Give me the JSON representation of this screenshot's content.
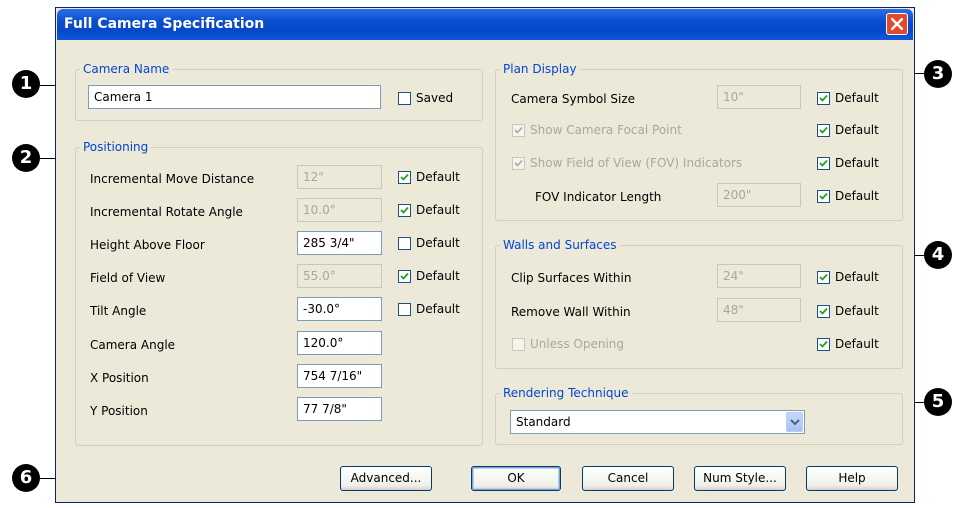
{
  "window": {
    "title": "Full Camera Specification"
  },
  "camera_name": {
    "legend": "Camera Name",
    "value": "Camera 1",
    "saved_label": "Saved",
    "saved_checked": false
  },
  "positioning": {
    "legend": "Positioning",
    "rows": [
      {
        "label": "Incremental Move Distance",
        "value": "12\"",
        "enabled": false,
        "default_label": "Default",
        "default_checked": true
      },
      {
        "label": "Incremental Rotate Angle",
        "value": "10.0°",
        "enabled": false,
        "default_label": "Default",
        "default_checked": true
      },
      {
        "label": "Height Above Floor",
        "value": "285 3/4\"",
        "enabled": true,
        "default_label": "Default",
        "default_checked": false
      },
      {
        "label": "Field of View",
        "value": "55.0°",
        "enabled": false,
        "default_label": "Default",
        "default_checked": true
      },
      {
        "label": "Tilt Angle",
        "value": "-30.0°",
        "enabled": true,
        "default_label": "Default",
        "default_checked": false
      },
      {
        "label": "Camera Angle",
        "value": "120.0°",
        "enabled": true
      },
      {
        "label": "X Position",
        "value": "754 7/16\"",
        "enabled": true
      },
      {
        "label": "Y Position",
        "value": "77 7/8\"",
        "enabled": true
      }
    ]
  },
  "plan_display": {
    "legend": "Plan Display",
    "symbol_size_label": "Camera Symbol Size",
    "symbol_size_value": "10\"",
    "show_focal_label": "Show Camera Focal Point",
    "show_fov_label": "Show Field of View (FOV) Indicators",
    "fov_length_label": "FOV Indicator Length",
    "fov_length_value": "200\"",
    "default_label": "Default"
  },
  "walls_surfaces": {
    "legend": "Walls and Surfaces",
    "clip_label": "Clip Surfaces Within",
    "clip_value": "24\"",
    "remove_label": "Remove Wall Within",
    "remove_value": "48\"",
    "unless_label": "Unless Opening",
    "default_label": "Default"
  },
  "rendering": {
    "legend": "Rendering Technique",
    "selected": "Standard"
  },
  "buttons": {
    "advanced": "Advanced...",
    "ok": "OK",
    "cancel": "Cancel",
    "num_style": "Num Style...",
    "help": "Help"
  },
  "callouts": [
    "1",
    "2",
    "3",
    "4",
    "5",
    "6"
  ],
  "colors": {
    "title_bar": "#0a4ed0",
    "dialog_bg": "#ece9d8",
    "legend_text": "#0046d5",
    "close_button": "#e0492c"
  }
}
